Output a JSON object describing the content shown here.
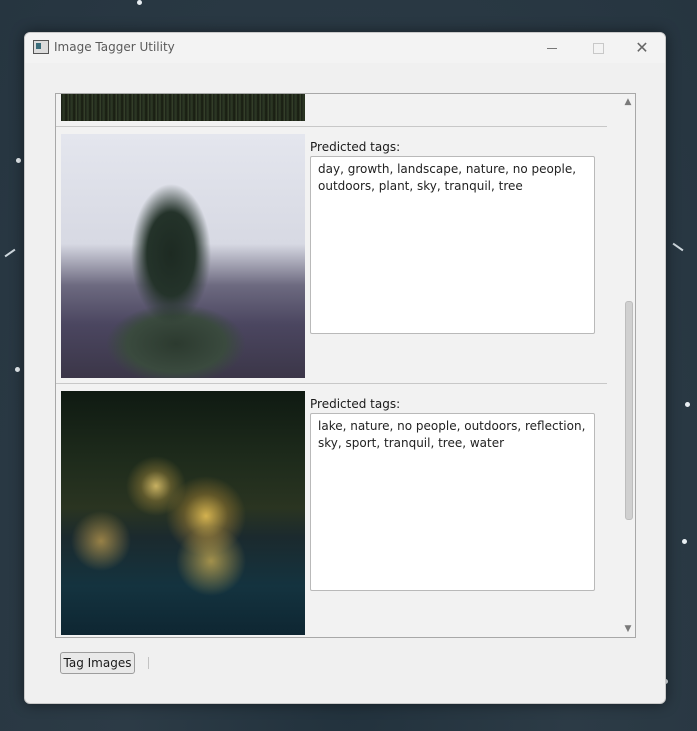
{
  "window": {
    "title": "Image Tagger Utility",
    "controls": {
      "minimize": "minimize-icon",
      "maximize": "maximize-icon",
      "close": "✕"
    }
  },
  "items": [
    {
      "label": "Predicted tags:",
      "tags": "day, growth, landscape, nature, no people, outdoors, plant, sky, tranquil, tree"
    },
    {
      "label": "Predicted tags:",
      "tags": "lake, nature, no people, outdoors, reflection, sky, sport, tranquil, tree, water"
    }
  ],
  "scrollbar": {
    "up": "▲",
    "down": "▼"
  },
  "footer": {
    "tag_button": "Tag Images"
  }
}
